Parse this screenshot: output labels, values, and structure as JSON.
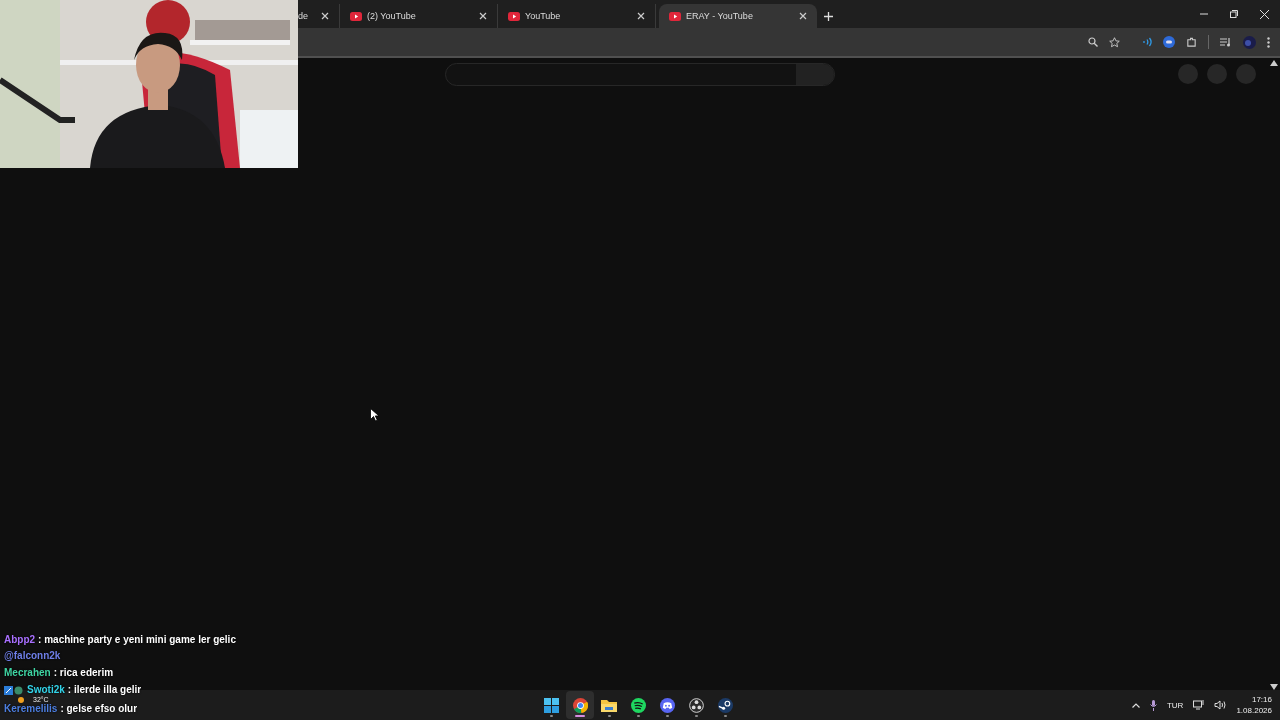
{
  "browser": {
    "tabs": [
      {
        "title": "de",
        "favicon": false,
        "selected": false
      },
      {
        "title": "(2) YouTube",
        "favicon": true,
        "selected": false
      },
      {
        "title": "YouTube",
        "favicon": true,
        "selected": false
      },
      {
        "title": "ERAY - YouTube",
        "favicon": true,
        "selected": true
      }
    ]
  },
  "chat": {
    "messages": [
      {
        "user": "Abpp2",
        "color": "#a970ff",
        "text": ": machine party e yeni mini game ler gelic"
      },
      {
        "user": "@falconn2k",
        "color": "#6f7fe8"
      },
      {
        "user": "Mecrahen",
        "color": "#3fd6a4",
        "text": ": rica ederim"
      },
      {
        "user": "Swoti2k",
        "color": "#33d3e8",
        "text": ": ilerde illa gelir",
        "badges": true
      },
      {
        "user": "Keremelilis",
        "color": "#4d7fe0",
        "text": ": gelse efso olur"
      }
    ]
  },
  "taskbar": {
    "weather": "32°C",
    "apps": [
      {
        "kind": "start",
        "selected": false
      },
      {
        "kind": "chrome",
        "selected": true
      },
      {
        "kind": "folder",
        "selected": false
      },
      {
        "kind": "spotify",
        "selected": false
      },
      {
        "kind": "discord",
        "selected": false
      },
      {
        "kind": "obs",
        "selected": false
      },
      {
        "kind": "steam",
        "selected": false
      }
    ],
    "language": "TUR",
    "time": "17:16",
    "date": "1.08.2026"
  }
}
